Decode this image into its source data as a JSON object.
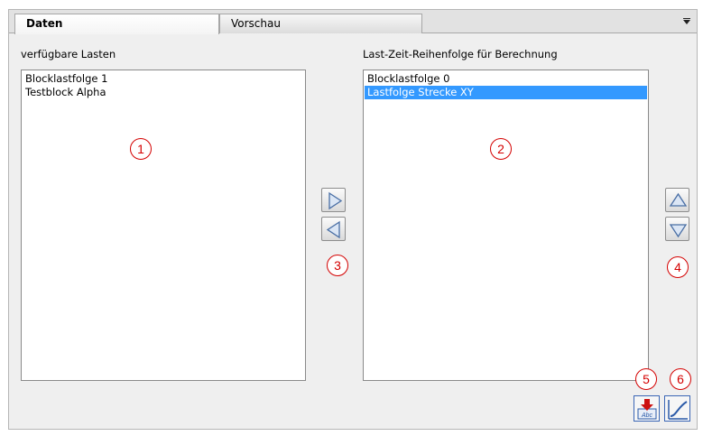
{
  "tabs": [
    {
      "label": "Daten",
      "active": true
    },
    {
      "label": "Vorschau",
      "active": false
    }
  ],
  "left_panel": {
    "label": "verfügbare Lasten",
    "items": [
      "Blocklastfolge 1",
      "Testblock Alpha"
    ]
  },
  "right_panel": {
    "label": "Last-Zeit-Reihenfolge für Berechnung",
    "items": [
      "Blocklastfolge 0",
      "Lastfolge Strecke XY"
    ],
    "selected_index": 1
  },
  "markers": {
    "m1": "1",
    "m2": "2",
    "m3": "3",
    "m4": "4",
    "m5": "5",
    "m6": "6"
  },
  "icons": {
    "tab_menu": "dropdown-menu-icon",
    "move_right": "triangle-right-icon",
    "move_left": "triangle-left-icon",
    "move_up": "triangle-up-icon",
    "move_down": "triangle-down-icon",
    "import": "import-abc-icon",
    "curve": "curve-chart-icon"
  },
  "colors": {
    "selection": "#3399ff",
    "marker": "#d40000",
    "button_border": "#3a66b5"
  }
}
